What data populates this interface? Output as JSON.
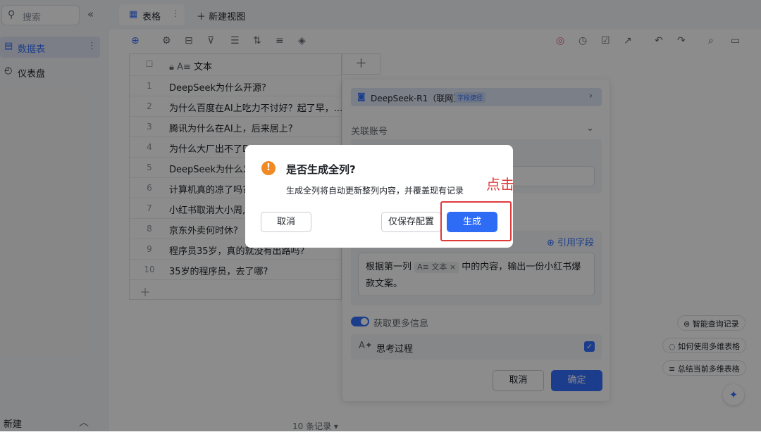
{
  "sidebar": {
    "search_placeholder": "搜索",
    "collapse_glyph": "«",
    "items": [
      {
        "label": "数据表",
        "icon": "table-icon"
      },
      {
        "label": "仪表盘",
        "icon": "dashboard-icon"
      }
    ],
    "new_label": "新建"
  },
  "tabs": {
    "active": "表格",
    "new_view": "新建视图"
  },
  "grid": {
    "column_header": "文本",
    "rows": [
      {
        "n": "1",
        "text": "DeepSeek为什么开源?"
      },
      {
        "n": "2",
        "text": "为什么百度在AI上吃力不讨好？起了早，..."
      },
      {
        "n": "3",
        "text": "腾讯为什么在AI上，后来居上?"
      },
      {
        "n": "4",
        "text": "为什么大厂出不了De"
      },
      {
        "n": "5",
        "text": "DeepSeek为什么发"
      },
      {
        "n": "6",
        "text": "计算机真的凉了吗?"
      },
      {
        "n": "7",
        "text": "小红书取消大小周,"
      },
      {
        "n": "8",
        "text": "京东外卖何时休?"
      },
      {
        "n": "9",
        "text": "程序员35岁，真的就没有出路吗?"
      },
      {
        "n": "10",
        "text": "35岁的程序员，去了哪?"
      }
    ],
    "record_count": "10 条记录"
  },
  "panel": {
    "model": "DeepSeek-R1（联网）",
    "model_tag": "字段捷径",
    "account_label": "关联账号",
    "ref_field": "引用字段",
    "prompt_prefix": "根据第一列",
    "prompt_chip": "A≡ 文本 ×",
    "prompt_suffix": "中的内容，输出一份小红书爆款文案。",
    "more_info": "获取更多信息",
    "think": "思考过程",
    "cancel": "取消",
    "ok": "确定"
  },
  "floating": {
    "query_log": "智能查询记录",
    "how_to": "如何使用多维表格",
    "summarize": "总结当前多维表格"
  },
  "dialog": {
    "title": "是否生成全列?",
    "body": "生成全列将自动更新整列内容，并覆盖现有记录",
    "cancel": "取消",
    "save_only": "仅保存配置",
    "generate": "生成"
  },
  "annotation": {
    "click_note": "点击",
    "color": "#e03a3a"
  },
  "colors": {
    "accent": "#3370ff",
    "warning": "#f08a24"
  }
}
